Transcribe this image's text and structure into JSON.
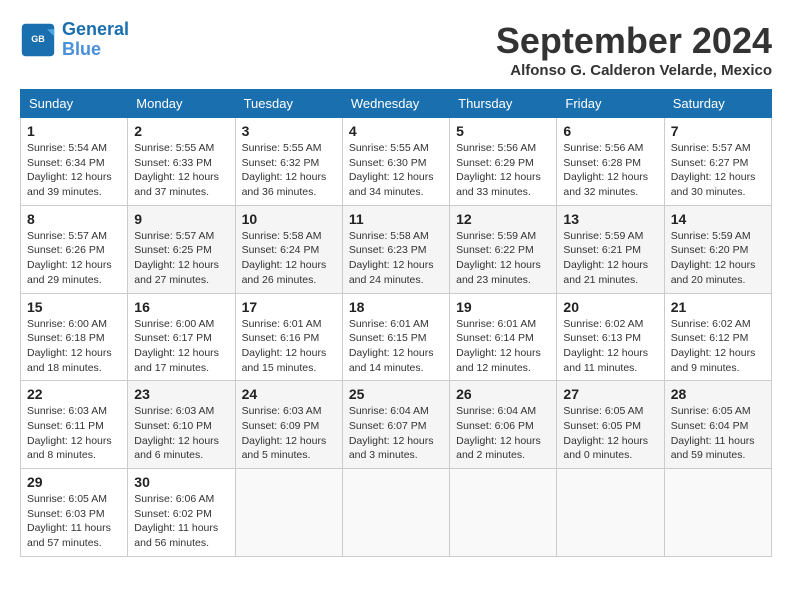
{
  "header": {
    "logo_line1": "General",
    "logo_line2": "Blue",
    "month": "September 2024",
    "location": "Alfonso G. Calderon Velarde, Mexico"
  },
  "days_of_week": [
    "Sunday",
    "Monday",
    "Tuesday",
    "Wednesday",
    "Thursday",
    "Friday",
    "Saturday"
  ],
  "weeks": [
    [
      {
        "num": "1",
        "sunrise": "Sunrise: 5:54 AM",
        "sunset": "Sunset: 6:34 PM",
        "daylight": "Daylight: 12 hours and 39 minutes."
      },
      {
        "num": "2",
        "sunrise": "Sunrise: 5:55 AM",
        "sunset": "Sunset: 6:33 PM",
        "daylight": "Daylight: 12 hours and 37 minutes."
      },
      {
        "num": "3",
        "sunrise": "Sunrise: 5:55 AM",
        "sunset": "Sunset: 6:32 PM",
        "daylight": "Daylight: 12 hours and 36 minutes."
      },
      {
        "num": "4",
        "sunrise": "Sunrise: 5:55 AM",
        "sunset": "Sunset: 6:30 PM",
        "daylight": "Daylight: 12 hours and 34 minutes."
      },
      {
        "num": "5",
        "sunrise": "Sunrise: 5:56 AM",
        "sunset": "Sunset: 6:29 PM",
        "daylight": "Daylight: 12 hours and 33 minutes."
      },
      {
        "num": "6",
        "sunrise": "Sunrise: 5:56 AM",
        "sunset": "Sunset: 6:28 PM",
        "daylight": "Daylight: 12 hours and 32 minutes."
      },
      {
        "num": "7",
        "sunrise": "Sunrise: 5:57 AM",
        "sunset": "Sunset: 6:27 PM",
        "daylight": "Daylight: 12 hours and 30 minutes."
      }
    ],
    [
      {
        "num": "8",
        "sunrise": "Sunrise: 5:57 AM",
        "sunset": "Sunset: 6:26 PM",
        "daylight": "Daylight: 12 hours and 29 minutes."
      },
      {
        "num": "9",
        "sunrise": "Sunrise: 5:57 AM",
        "sunset": "Sunset: 6:25 PM",
        "daylight": "Daylight: 12 hours and 27 minutes."
      },
      {
        "num": "10",
        "sunrise": "Sunrise: 5:58 AM",
        "sunset": "Sunset: 6:24 PM",
        "daylight": "Daylight: 12 hours and 26 minutes."
      },
      {
        "num": "11",
        "sunrise": "Sunrise: 5:58 AM",
        "sunset": "Sunset: 6:23 PM",
        "daylight": "Daylight: 12 hours and 24 minutes."
      },
      {
        "num": "12",
        "sunrise": "Sunrise: 5:59 AM",
        "sunset": "Sunset: 6:22 PM",
        "daylight": "Daylight: 12 hours and 23 minutes."
      },
      {
        "num": "13",
        "sunrise": "Sunrise: 5:59 AM",
        "sunset": "Sunset: 6:21 PM",
        "daylight": "Daylight: 12 hours and 21 minutes."
      },
      {
        "num": "14",
        "sunrise": "Sunrise: 5:59 AM",
        "sunset": "Sunset: 6:20 PM",
        "daylight": "Daylight: 12 hours and 20 minutes."
      }
    ],
    [
      {
        "num": "15",
        "sunrise": "Sunrise: 6:00 AM",
        "sunset": "Sunset: 6:18 PM",
        "daylight": "Daylight: 12 hours and 18 minutes."
      },
      {
        "num": "16",
        "sunrise": "Sunrise: 6:00 AM",
        "sunset": "Sunset: 6:17 PM",
        "daylight": "Daylight: 12 hours and 17 minutes."
      },
      {
        "num": "17",
        "sunrise": "Sunrise: 6:01 AM",
        "sunset": "Sunset: 6:16 PM",
        "daylight": "Daylight: 12 hours and 15 minutes."
      },
      {
        "num": "18",
        "sunrise": "Sunrise: 6:01 AM",
        "sunset": "Sunset: 6:15 PM",
        "daylight": "Daylight: 12 hours and 14 minutes."
      },
      {
        "num": "19",
        "sunrise": "Sunrise: 6:01 AM",
        "sunset": "Sunset: 6:14 PM",
        "daylight": "Daylight: 12 hours and 12 minutes."
      },
      {
        "num": "20",
        "sunrise": "Sunrise: 6:02 AM",
        "sunset": "Sunset: 6:13 PM",
        "daylight": "Daylight: 12 hours and 11 minutes."
      },
      {
        "num": "21",
        "sunrise": "Sunrise: 6:02 AM",
        "sunset": "Sunset: 6:12 PM",
        "daylight": "Daylight: 12 hours and 9 minutes."
      }
    ],
    [
      {
        "num": "22",
        "sunrise": "Sunrise: 6:03 AM",
        "sunset": "Sunset: 6:11 PM",
        "daylight": "Daylight: 12 hours and 8 minutes."
      },
      {
        "num": "23",
        "sunrise": "Sunrise: 6:03 AM",
        "sunset": "Sunset: 6:10 PM",
        "daylight": "Daylight: 12 hours and 6 minutes."
      },
      {
        "num": "24",
        "sunrise": "Sunrise: 6:03 AM",
        "sunset": "Sunset: 6:09 PM",
        "daylight": "Daylight: 12 hours and 5 minutes."
      },
      {
        "num": "25",
        "sunrise": "Sunrise: 6:04 AM",
        "sunset": "Sunset: 6:07 PM",
        "daylight": "Daylight: 12 hours and 3 minutes."
      },
      {
        "num": "26",
        "sunrise": "Sunrise: 6:04 AM",
        "sunset": "Sunset: 6:06 PM",
        "daylight": "Daylight: 12 hours and 2 minutes."
      },
      {
        "num": "27",
        "sunrise": "Sunrise: 6:05 AM",
        "sunset": "Sunset: 6:05 PM",
        "daylight": "Daylight: 12 hours and 0 minutes."
      },
      {
        "num": "28",
        "sunrise": "Sunrise: 6:05 AM",
        "sunset": "Sunset: 6:04 PM",
        "daylight": "Daylight: 11 hours and 59 minutes."
      }
    ],
    [
      {
        "num": "29",
        "sunrise": "Sunrise: 6:05 AM",
        "sunset": "Sunset: 6:03 PM",
        "daylight": "Daylight: 11 hours and 57 minutes."
      },
      {
        "num": "30",
        "sunrise": "Sunrise: 6:06 AM",
        "sunset": "Sunset: 6:02 PM",
        "daylight": "Daylight: 11 hours and 56 minutes."
      },
      null,
      null,
      null,
      null,
      null
    ]
  ]
}
